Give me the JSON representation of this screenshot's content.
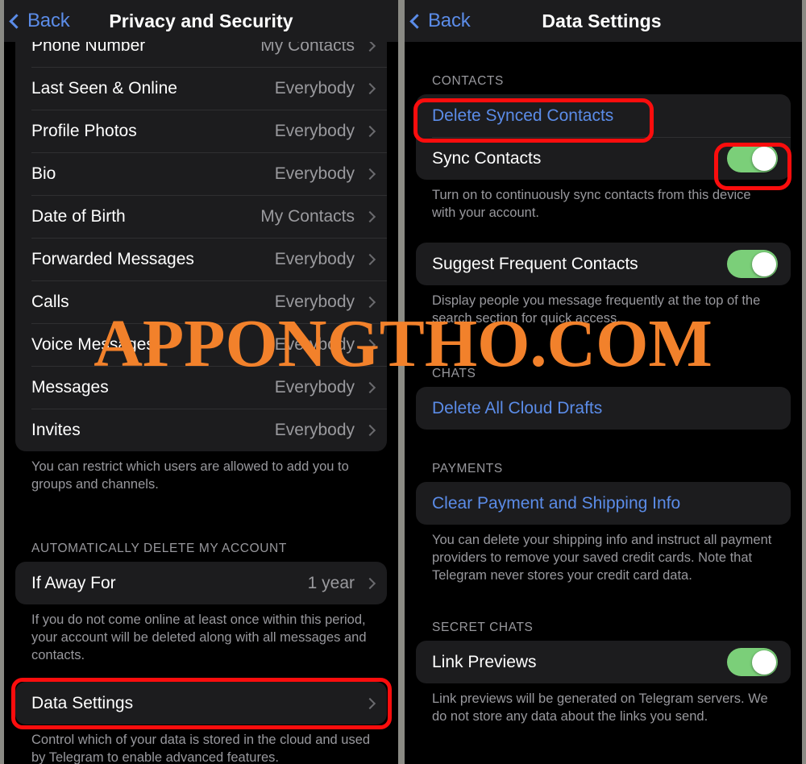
{
  "watermark": {
    "text": "APPONGTHO.COM",
    "color": "#f2812b"
  },
  "theme": {
    "accent_blue": "#5b8ce8",
    "toggle_on_green": "#7bcf79",
    "highlight_red": "#fb0d0d",
    "card_bg": "#1c1c1e",
    "page_bg": "#000000"
  },
  "left_panel": {
    "nav": {
      "back_label": "Back",
      "title": "Privacy and Security"
    },
    "privacy_rows": [
      {
        "label": "Phone Number",
        "value": "My Contacts"
      },
      {
        "label": "Last Seen & Online",
        "value": "Everybody"
      },
      {
        "label": "Profile Photos",
        "value": "Everybody"
      },
      {
        "label": "Bio",
        "value": "Everybody"
      },
      {
        "label": "Date of Birth",
        "value": "My Contacts"
      },
      {
        "label": "Forwarded Messages",
        "value": "Everybody"
      },
      {
        "label": "Calls",
        "value": "Everybody"
      },
      {
        "label": "Voice Messages",
        "value": "Everybody"
      },
      {
        "label": "Messages",
        "value": "Everybody"
      },
      {
        "label": "Invites",
        "value": "Everybody"
      }
    ],
    "privacy_footer": "You can restrict which users are allowed to add you to groups and channels.",
    "auto_delete": {
      "section_header": "AUTOMATICALLY DELETE MY ACCOUNT",
      "row_label": "If Away For",
      "row_value": "1 year",
      "footer": "If you do not come online at least once within this period, your account will be deleted along with all messages and contacts."
    },
    "data_settings": {
      "row_label": "Data Settings",
      "footer": "Control which of your data is stored in the cloud and used by Telegram to enable advanced features."
    }
  },
  "right_panel": {
    "nav": {
      "back_label": "Back",
      "title": "Data Settings"
    },
    "contacts": {
      "section_header": "CONTACTS",
      "delete_synced_label": "Delete Synced Contacts",
      "sync_label": "Sync Contacts",
      "sync_toggle": "on",
      "footer": "Turn on to continuously sync contacts from this device with your account."
    },
    "frequent": {
      "label": "Suggest Frequent Contacts",
      "toggle": "on",
      "footer": "Display people you message frequently at the top of the search section for quick access."
    },
    "chats": {
      "section_header": "CHATS",
      "delete_drafts_label": "Delete All Cloud Drafts"
    },
    "payments": {
      "section_header": "PAYMENTS",
      "clear_label": "Clear Payment and Shipping Info",
      "footer": "You can delete your shipping info and instruct all payment providers to remove your saved credit cards. Note that Telegram never stores your credit card data."
    },
    "secret_chats": {
      "section_header": "SECRET CHATS",
      "link_previews_label": "Link Previews",
      "toggle": "on",
      "footer": "Link previews will be generated on Telegram servers. We do not store any data about the links you send."
    }
  }
}
